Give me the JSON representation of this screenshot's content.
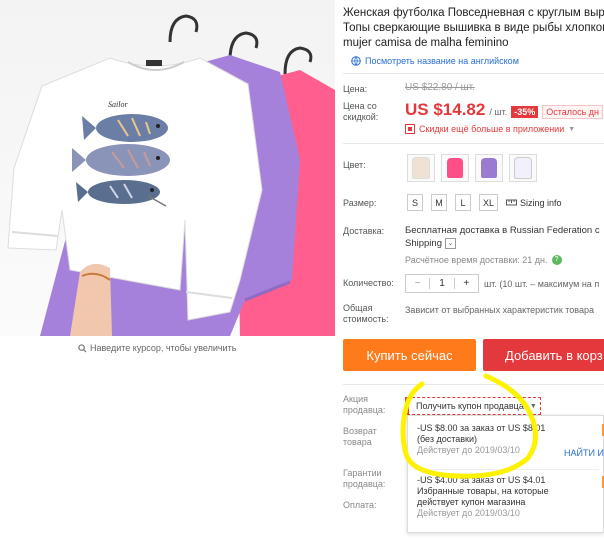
{
  "product": {
    "title_lines": [
      "Женская футболка Повседневная с круглым выре",
      "Топы сверкающие вышивка в виде рыбы хлопков",
      "mujer camisa de malha feminino"
    ],
    "translate_link": "Посмотреть название на английском",
    "image_hint": "Наведите курсор, чтобы увеличить",
    "shirt_text": "Sailor"
  },
  "pricing": {
    "price_label": "Цена:",
    "old_price": "US $22.80 / шт.",
    "discount_label": "Цена со скидкой:",
    "new_price": "US $14.82",
    "per_unit": "/ шт.",
    "discount_badge": "-35%",
    "remaining": "Осталось дн",
    "app_promo": "Скидки ещё больше в приложении"
  },
  "options": {
    "color_label": "Цвет:",
    "size_label": "Размер:",
    "sizes": [
      "S",
      "M",
      "L",
      "XL"
    ],
    "sizing_info": "Sizing info",
    "colors": [
      "#f2e6dc",
      "#ff4f88",
      "#9b7ad1",
      "#e8e4f7"
    ]
  },
  "shipping": {
    "label": "Доставка:",
    "free_text": "Бесплатная доставка в Russian Federation с",
    "method": "Shipping",
    "time_text": "Расчётное время доставки: 21 дн."
  },
  "quantity": {
    "label": "Количество:",
    "value": "1",
    "minus": "−",
    "plus": "+",
    "note": "шт. (10 шт. – максимум на п"
  },
  "total": {
    "label": "Общая стоимость:",
    "note": "Зависит от выбранных характеристик товара"
  },
  "actions": {
    "buy_now": "Купить сейчас",
    "add_to_cart": "Добавить в корз"
  },
  "promo": {
    "seller_promo_label": "Акция продавца:",
    "coupon_button": "Получить купон продавца",
    "return_label": "Возврат товара",
    "guarantee_label": "Гарантии продавца:",
    "payment_label": "Оплата:",
    "collect_link": "НАЙТИ ИЗ",
    "coupons": [
      {
        "line1": "-US $8.00 за заказ от US $8.01",
        "line2": "(без доставки)",
        "expires": "Действует до 2019/03/10"
      },
      {
        "line1": "-US $4.00 за заказ от US $4.01",
        "line2": "Избранные товары, на которые",
        "line3": "действует купон магазина",
        "expires": "Действует до 2019/03/10"
      }
    ]
  },
  "colors": {
    "accent_red": "#e4393c",
    "buy_orange": "#ff7a1a",
    "link_blue": "#2a6fd6",
    "highlight_yellow": "#fff200"
  }
}
